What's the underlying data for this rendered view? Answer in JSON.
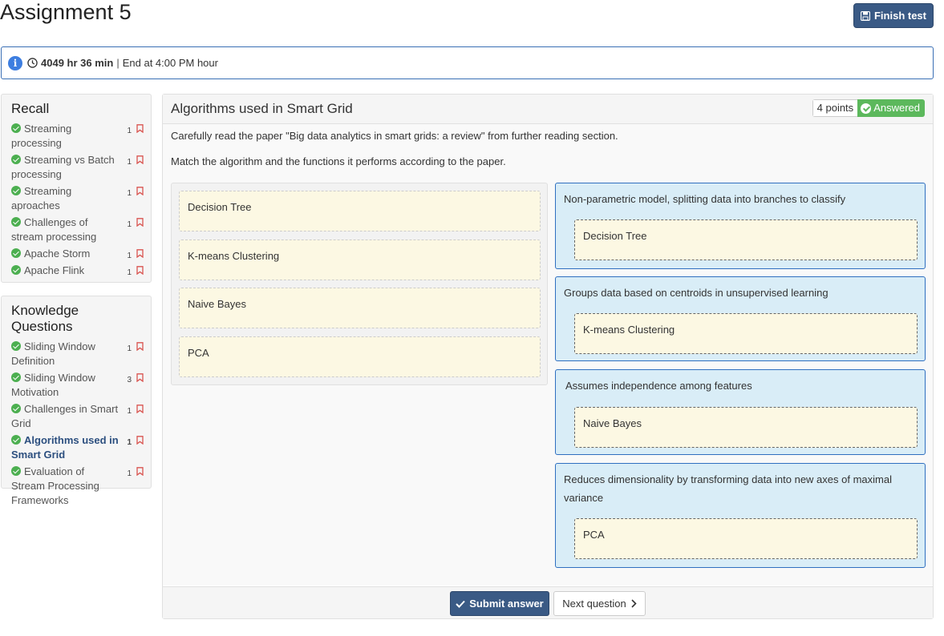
{
  "page": {
    "title": "Assignment 5",
    "finish_label": "Finish test"
  },
  "timer": {
    "remaining": "4049 hr 36 min",
    "separator": "|",
    "end_text": "End at 4:00 PM hour"
  },
  "sidebar": {
    "recall": {
      "title": "Recall",
      "items": [
        {
          "label": "Streaming processing",
          "count": "1"
        },
        {
          "label": "Streaming vs Batch processing",
          "count": "1"
        },
        {
          "label": "Streaming aproaches",
          "count": "1"
        },
        {
          "label": "Challenges of stream processing",
          "count": "1"
        },
        {
          "label": "Apache Storm",
          "count": "1"
        },
        {
          "label": "Apache Flink",
          "count": "1"
        }
      ]
    },
    "knowledge": {
      "title": "Knowledge Questions",
      "items": [
        {
          "label": "Sliding Window Definition",
          "count": "1"
        },
        {
          "label": "Sliding Window Motivation",
          "count": "3"
        },
        {
          "label": "Challenges in Smart Grid",
          "count": "1"
        },
        {
          "label": "Algorithms used in Smart Grid",
          "count": "1",
          "active": true
        },
        {
          "label": "Evaluation of Stream Processing Frameworks",
          "count": "1"
        }
      ]
    }
  },
  "question": {
    "title": "Algorithms used in Smart Grid",
    "points": "4 points",
    "status": "Answered",
    "instructions": [
      "Carefully read the paper \"Big data analytics in smart grids: a review\" from further reading section.",
      "Match the algorithm and the functions it performs according to the paper."
    ],
    "options": [
      "Decision Tree",
      "K-means Clustering",
      "Naive Bayes",
      "PCA"
    ],
    "targets": [
      {
        "description": "Non-parametric model, splitting data into branches to classify",
        "answer": "Decision Tree"
      },
      {
        "description": "Groups data based on centroids in unsupervised learning",
        "answer": "K-means Clustering"
      },
      {
        "description": "Assumes independence among features",
        "answer": "Naive Bayes"
      },
      {
        "description": "Reduces dimensionality by transforming data into new axes of maximal variance",
        "answer": "PCA"
      }
    ]
  },
  "actions": {
    "submit_label": "Submit answer",
    "next_label": "Next question"
  },
  "colors": {
    "primary": "#3a5a85",
    "success": "#5cb85c",
    "info_border": "#3a6fb5",
    "target_bg": "#d9edf7",
    "option_bg": "#fcf8e3"
  }
}
